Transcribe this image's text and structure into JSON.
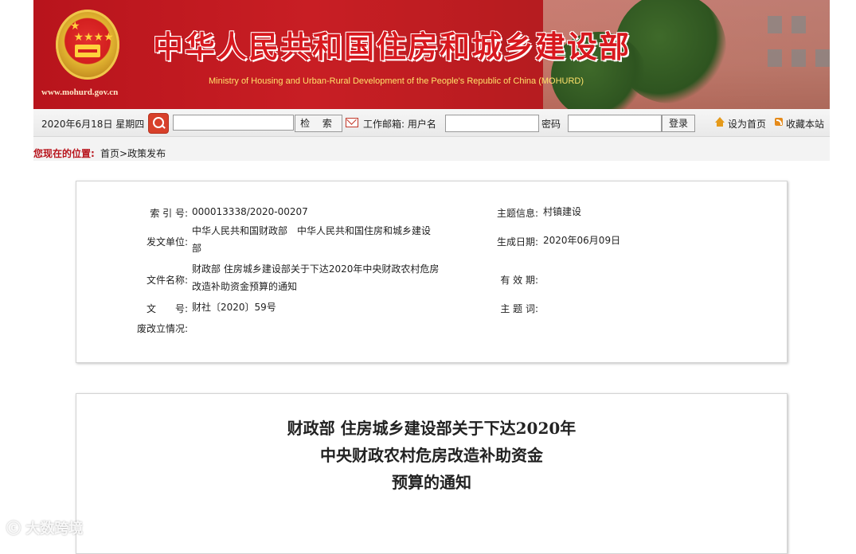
{
  "header": {
    "site_url": "www.mohurd.gov.cn",
    "title_cn": "中华人民共和国住房和城乡建设部",
    "title_en": "Ministry of Housing and Urban-Rural Development of the People's Republic of China (MOHURD)"
  },
  "toolbar": {
    "date": "2020年6月18日 星期四",
    "search_value": "",
    "search_button": "检 索",
    "mail_label": "工作邮箱: 用户名",
    "username_value": "",
    "password_label": "密码",
    "password_value": "",
    "login_button": "登录",
    "set_home": "设为首页",
    "bookmark": "收藏本站"
  },
  "breadcrumb": {
    "label": "您现在的位置:",
    "home": "首页",
    "separator": ">",
    "current": "政策发布"
  },
  "info": {
    "index_label": "索 引 号:",
    "index_value": "000013338/2020-00207",
    "topic_label": "主题信息:",
    "topic_value": "村镇建设",
    "issuer_label": "发文单位:",
    "issuer_value": "中华人民共和国财政部　中华人民共和国住房和城乡建设部",
    "date_label": "生成日期:",
    "date_value": "2020年06月09日",
    "name_label": "文件名称:",
    "name_value": "财政部 住房城乡建设部关于下达2020年中央财政农村危房改造补助资金预算的通知",
    "valid_label": "有 效 期:",
    "valid_value": "",
    "doc_no_label": "文　　号:",
    "doc_no_value": "财社〔2020〕59号",
    "keywords_label": "主 题 词:",
    "keywords_value": "",
    "status_label": "废改立情况:",
    "status_value": ""
  },
  "article": {
    "title_line1": "财政部 住房城乡建设部关于下达2020年",
    "title_line2": "中央财政农村危房改造补助资金",
    "title_line3": "预算的通知"
  },
  "watermark": "大数跨境"
}
